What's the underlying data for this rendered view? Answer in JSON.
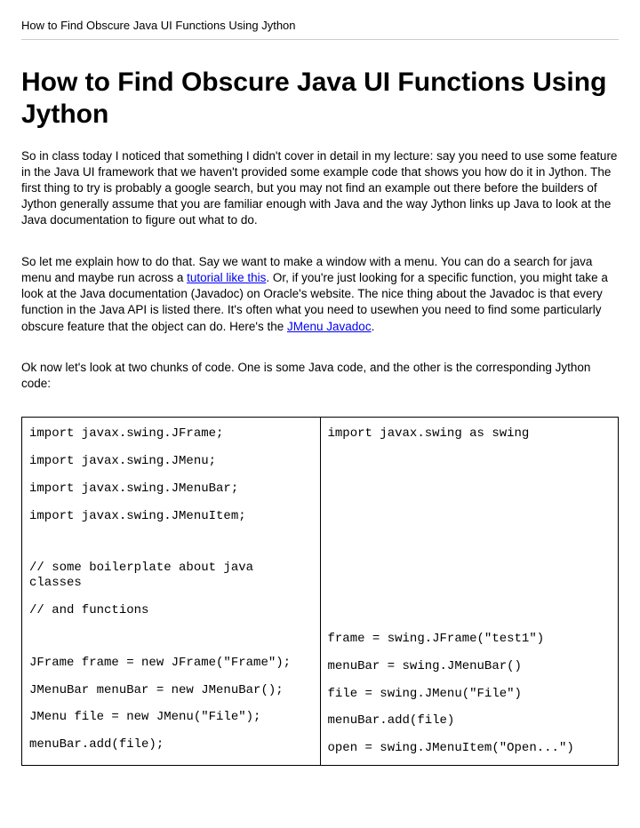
{
  "header": "How to Find Obscure Java UI Functions Using Jython",
  "title": "How to Find Obscure Java UI Functions Using Jython",
  "p1": "So in class today I noticed that something I didn't cover in detail in my lecture: say you need to use some feature in the Java UI framework that we haven't provided some example code that shows you how do it in Jython.  The first thing to try is probably a google search, but you may not find an example out there before the builders of Jython generally assume that you are familiar enough with Java and the way Jython links up Java to look at the Java documentation to figure out what to do.",
  "p2a": "So let me explain how to do that.  Say we want to make a window with a menu.     You can do a search for java menu and maybe run across a ",
  "p2link1": "tutorial like this",
  "p2b": ".  Or, if you're just looking for a specific function, you might take a look at the Java documentation (Javadoc) on Oracle's website.  The nice thing about the Javadoc is that every function in the Java API is listed there.  It's often what you need to usewhen you need to find some particularly obscure feature that the object can do.  Here's the ",
  "p2link2": "JMenu Javadoc",
  "p2c": ".",
  "p3": "Ok now let's look at two chunks of code.  One is some Java code, and the other is the corresponding Jython code:",
  "java": {
    "l1": "import javax.swing.JFrame;",
    "l2": "import javax.swing.JMenu;",
    "l3": "import javax.swing.JMenuBar;",
    "l4": "import javax.swing.JMenuItem;",
    "l5": "// some boilerplate about java classes",
    "l6": "// and functions",
    "l7": "JFrame frame = new JFrame(\"Frame\");",
    "l8": "JMenuBar menuBar = new JMenuBar();",
    "l9": "JMenu file = new JMenu(\"File\");",
    "l10": "menuBar.add(file);"
  },
  "jython": {
    "l1": "import javax.swing as swing",
    "l2": "frame = swing.JFrame(\"test1\")",
    "l3": "menuBar = swing.JMenuBar()",
    "l4": "file = swing.JMenu(\"File\")",
    "l5": "menuBar.add(file)",
    "l6": "open = swing.JMenuItem(\"Open...\")"
  }
}
